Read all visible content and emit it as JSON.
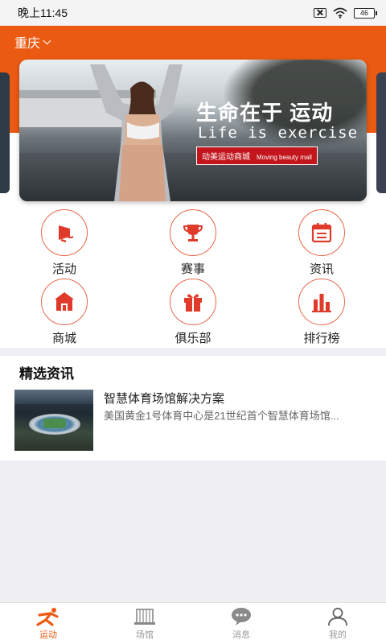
{
  "status_bar": {
    "time": "晚上11:45",
    "battery": "46"
  },
  "header": {
    "city": "重庆"
  },
  "banner": {
    "title": "生命在于 运动",
    "subtitle": "Life is exercise",
    "tag_cn": "动美运动商城",
    "tag_en": "Moving beauty mall"
  },
  "grid": [
    {
      "label": "活动",
      "icon": "megaphone-icon"
    },
    {
      "label": "赛事",
      "icon": "trophy-icon"
    },
    {
      "label": "资讯",
      "icon": "calendar-news-icon"
    },
    {
      "label": "商城",
      "icon": "store-icon"
    },
    {
      "label": "俱乐部",
      "icon": "gift-icon"
    },
    {
      "label": "排行榜",
      "icon": "ranking-bars-icon"
    }
  ],
  "news": {
    "section_title": "精选资讯",
    "items": [
      {
        "title": "智慧体育场馆解决方案",
        "desc": "美国黄金1号体育中心是21世纪首个智慧体育场馆..."
      }
    ]
  },
  "tabbar": [
    {
      "label": "运动",
      "active": true,
      "icon": "runner-icon"
    },
    {
      "label": "场馆",
      "active": false,
      "icon": "stadium-icon"
    },
    {
      "label": "消息",
      "active": false,
      "icon": "chat-bubble-icon"
    },
    {
      "label": "我的",
      "active": false,
      "icon": "person-icon"
    }
  ],
  "colors": {
    "accent": "#eb5a12",
    "icon_red": "#e03a2a"
  }
}
